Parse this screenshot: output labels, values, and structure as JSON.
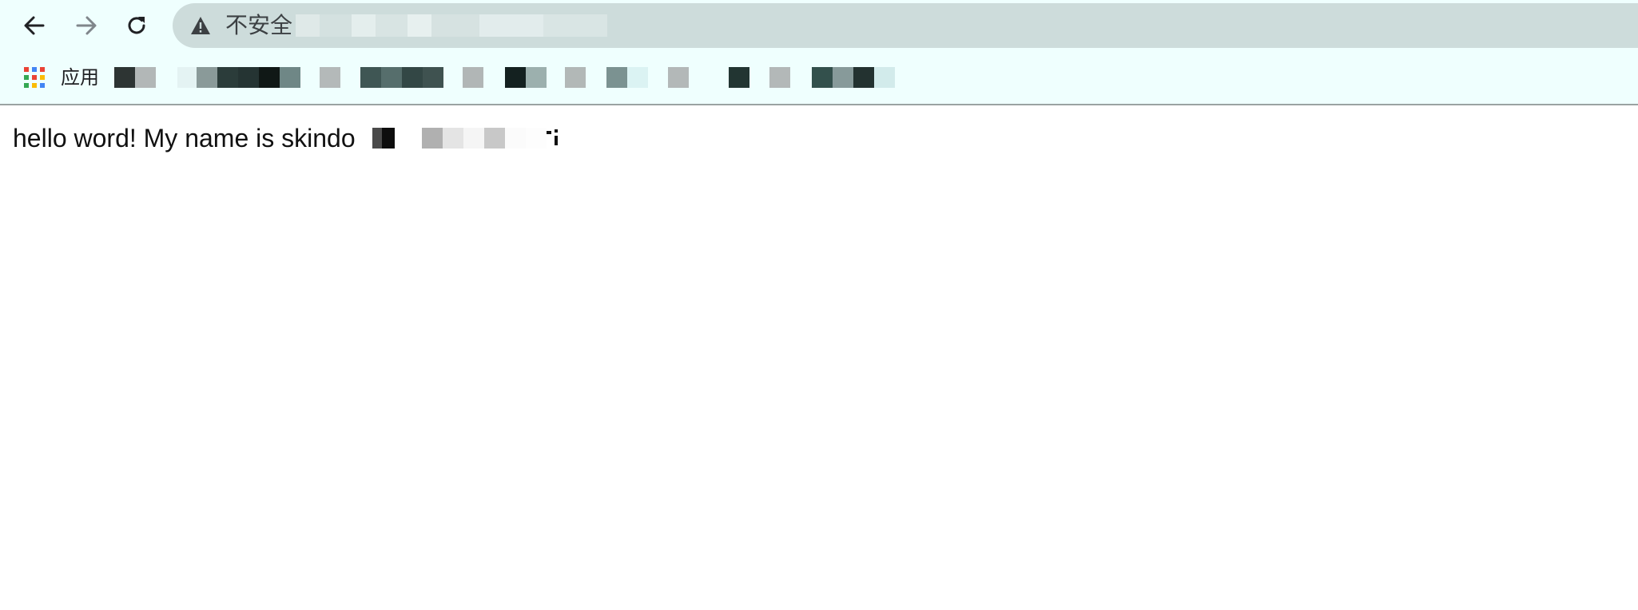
{
  "browser": {
    "nav": {
      "back_icon": "arrow-left-icon",
      "forward_icon": "arrow-right-icon",
      "reload_icon": "reload-icon"
    },
    "omnibox": {
      "security_icon": "warning-triangle-icon",
      "security_label": "不安全",
      "colors": {
        "background": "#cddcdb",
        "text": "#3c4043"
      }
    },
    "bookmarks": {
      "apps_icon": "apps-grid-icon",
      "apps_label": "应用",
      "colors": {
        "background": "#effffe"
      }
    }
  },
  "page": {
    "body_text": "hello word! My name is skindo"
  }
}
